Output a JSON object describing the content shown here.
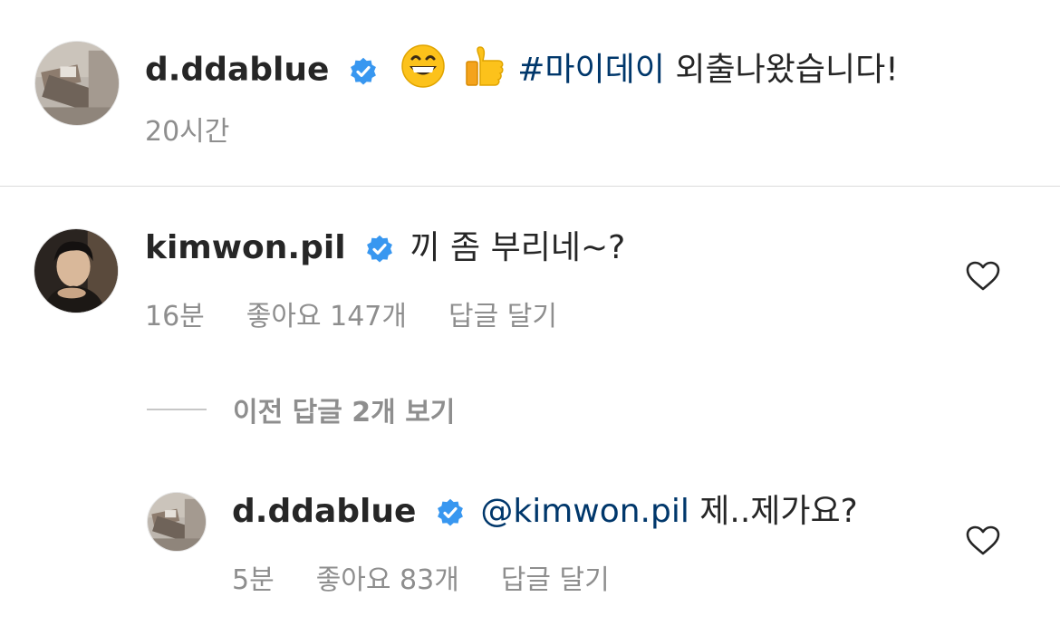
{
  "caption": {
    "username": "d.ddablue",
    "emojis": [
      "grinning-face-emoji",
      "thumbs-up-emoji"
    ],
    "hashtag": "#마이데이",
    "text": " 외출나왔습니다!",
    "time": "20시간"
  },
  "comment": {
    "username": "kimwon.pil",
    "text": "끼 좀 부리네~?",
    "time": "16분",
    "likes": "좋아요 147개",
    "reply": "답글 달기"
  },
  "view_replies": "이전 답글 2개 보기",
  "reply": {
    "username": "d.ddablue",
    "mention": "@kimwon.pil",
    "text": " 제..제가요?",
    "time": "5분",
    "likes": "좋아요 83개",
    "reply": "답글 달기"
  },
  "colors": {
    "text": "#262626",
    "secondary": "#8e8e8e",
    "link": "#00376b",
    "verified": "#3897f0"
  }
}
